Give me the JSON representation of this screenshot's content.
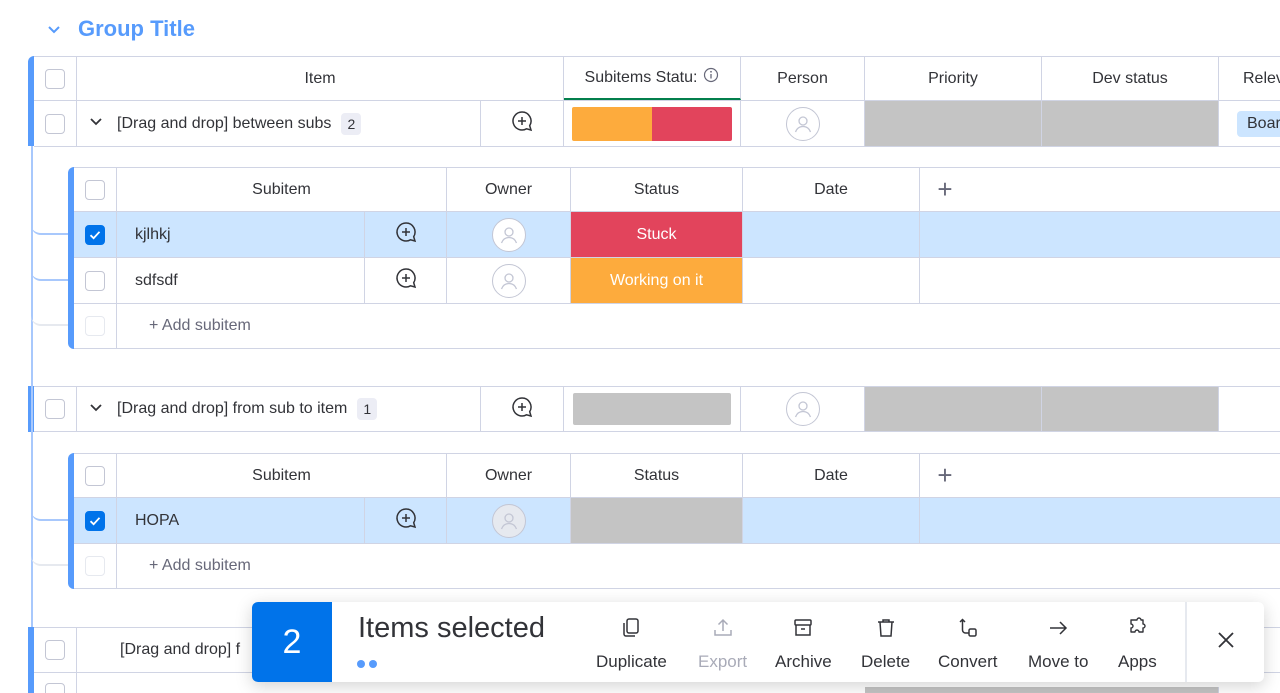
{
  "group": {
    "title": "Group Title",
    "color": "#579bfc"
  },
  "columns": {
    "item": "Item",
    "subitems_status": "Subitems Statu:",
    "person": "Person",
    "priority": "Priority",
    "dev_status": "Dev status",
    "relevant": "Relev"
  },
  "items": [
    {
      "name": "[Drag and drop] between subs",
      "count": "2",
      "relevant": "Boar"
    },
    {
      "name": "[Drag and drop] from sub to item",
      "count": "1"
    },
    {
      "name": "[Drag and drop] f"
    }
  ],
  "subitem_columns": {
    "subitem": "Subitem",
    "owner": "Owner",
    "status": "Status",
    "date": "Date",
    "add": "+"
  },
  "subitems_a": [
    {
      "name": "kjlhkj",
      "status": "Stuck",
      "status_color": "#e2445c",
      "checked": true
    },
    {
      "name": "sdfsdf",
      "status": "Working on it",
      "status_color": "#fdab3d",
      "checked": false
    }
  ],
  "subitems_b": [
    {
      "name": "HOPA",
      "status": "",
      "status_color": "#c4c4c4",
      "checked": true
    }
  ],
  "add_subitem": "+ Add subitem",
  "toolbar": {
    "count": "2",
    "label": "Items selected",
    "actions": [
      {
        "label": "Duplicate",
        "icon": "duplicate-icon"
      },
      {
        "label": "Export",
        "icon": "export-icon",
        "disabled": true
      },
      {
        "label": "Archive",
        "icon": "archive-icon"
      },
      {
        "label": "Delete",
        "icon": "trash-icon"
      },
      {
        "label": "Convert",
        "icon": "convert-icon"
      },
      {
        "label": "Move to",
        "icon": "arrow-right-icon"
      },
      {
        "label": "Apps",
        "icon": "apps-icon"
      }
    ]
  },
  "colors": {
    "accent": "#0073ea",
    "group": "#579bfc",
    "selected_row": "#cce5ff",
    "stuck": "#e2445c",
    "working": "#fdab3d",
    "empty": "#c4c4c4"
  }
}
